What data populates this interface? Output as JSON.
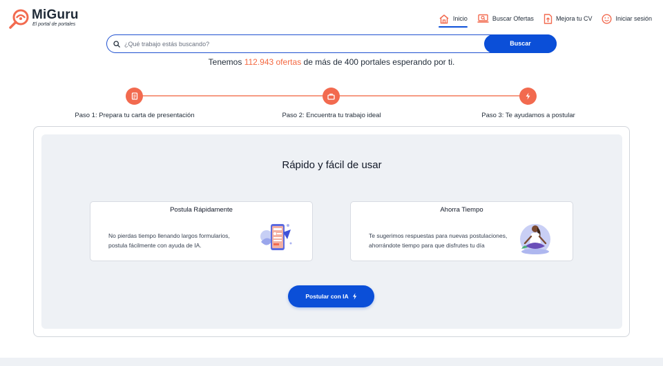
{
  "brand": {
    "name": "MiGuru",
    "tagline": "El portal de portales",
    "accent": "#f26a4f",
    "primary": "#0b4fd8"
  },
  "nav": {
    "items": [
      {
        "label": "Inicio",
        "icon": "home-icon",
        "active": true
      },
      {
        "label": "Buscar Ofertas",
        "icon": "search-laptop-icon"
      },
      {
        "label": "Mejora tu CV",
        "icon": "upload-document-icon"
      },
      {
        "label": "Iniciar sesión",
        "icon": "smile-face-icon"
      }
    ]
  },
  "search": {
    "placeholder": "¿Qué trabajo estás buscando?",
    "button_label": "Buscar"
  },
  "headline": {
    "prefix": "Tenemos ",
    "count": "112.943 ofertas",
    "suffix": " de más de 400 portales esperando por ti."
  },
  "steps": [
    {
      "label": "Paso 1: Prepara tu carta de presentación",
      "icon": "document-icon"
    },
    {
      "label": "Paso 2: Encuentra tu trabajo ideal",
      "icon": "briefcase-icon"
    },
    {
      "label": "Paso 3: Te ayudamos a postular",
      "icon": "lightning-icon"
    }
  ],
  "panel": {
    "title": "Rápido y fácil de usar",
    "features": [
      {
        "title": "Postula Rápidamente",
        "description": "No pierdas tiempo llenando largos formularios, postula fácilmente con ayuda de IA.",
        "illustration": "phone-form-illustration"
      },
      {
        "title": "Ahorra Tiempo",
        "description": "Te sugerimos respuestas para nuevas postulaciones, ahorrándote tiempo para que disfrutes tu día",
        "illustration": "meditating-woman-illustration"
      }
    ],
    "cta_label": "Postular con IA"
  }
}
